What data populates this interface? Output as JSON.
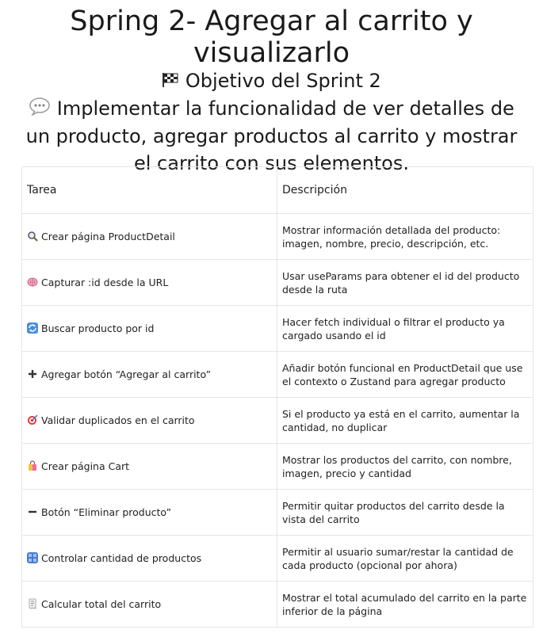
{
  "document": {
    "title": "Spring 2- Agregar al carrito y visualizarlo",
    "subtitle_icon": "checkered-flag-icon",
    "subtitle": "Objetivo del Sprint 2",
    "intro_icon": "speech-bubble-icon",
    "intro": "Implementar la funcionalidad de ver detalles de un producto, agregar productos al carrito y mostrar el carrito con sus elementos."
  },
  "table": {
    "headers": [
      "Tarea",
      "Descripción"
    ],
    "rows": [
      {
        "icon": "magnifier-icon",
        "task": "Crear página ProductDetail",
        "description": "Mostrar información detallada del producto: imagen, nombre, precio, descripción, etc."
      },
      {
        "icon": "brain-icon",
        "task": "Capturar :id desde la URL",
        "description": "Usar useParams para obtener el id del producto desde la ruta"
      },
      {
        "icon": "arrows-cycle-icon",
        "task": "Buscar producto por id",
        "description": "Hacer fetch individual o filtrar el producto ya cargado usando el id"
      },
      {
        "icon": "plus-icon",
        "task": "Agregar botón “Agregar al carrito”",
        "description": "Añadir botón funcional en ProductDetail que use el contexto o Zustand para agregar producto"
      },
      {
        "icon": "target-icon",
        "task": "Validar duplicados en el carrito",
        "description": "Si el producto ya está en el carrito, aumentar la cantidad, no duplicar"
      },
      {
        "icon": "shopping-bag-icon",
        "task": "Crear página Cart",
        "description": "Mostrar los productos del carrito, con nombre, imagen, precio y cantidad"
      },
      {
        "icon": "minus-icon",
        "task": "Botón “Eliminar producto”",
        "description": "Permitir quitar productos del carrito desde la vista del carrito"
      },
      {
        "icon": "numbers-icon",
        "task": "Controlar cantidad de productos",
        "description": "Permitir al usuario sumar/restar la cantidad de cada producto (opcional por ahora)"
      },
      {
        "icon": "receipt-icon",
        "task": "Calcular total del carrito",
        "description": "Mostrar el total acumulado del carrito en la parte inferior de la página"
      }
    ]
  }
}
